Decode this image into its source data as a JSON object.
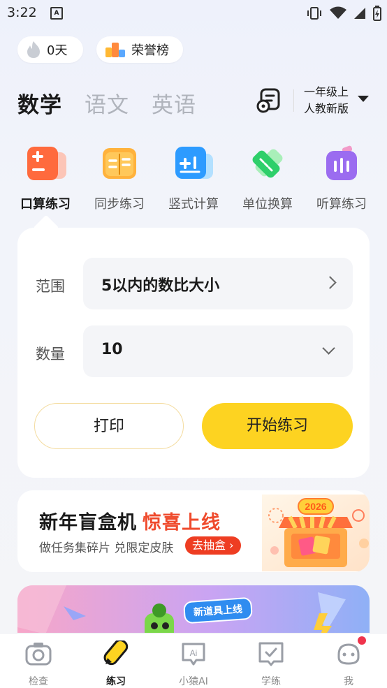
{
  "status_bar": {
    "time": "3:22",
    "notif_letter": "A"
  },
  "chips": {
    "streak": "0天",
    "honor": "荣誉榜"
  },
  "subjects": [
    {
      "label": "数学",
      "active": true
    },
    {
      "label": "语文",
      "active": false
    },
    {
      "label": "英语",
      "active": false
    }
  ],
  "grade": {
    "line1": "一年级上",
    "line2": "人教新版"
  },
  "practice_types": [
    {
      "label": "口算练习",
      "icon": "calculator-icon",
      "active": true
    },
    {
      "label": "同步练习",
      "icon": "book-icon"
    },
    {
      "label": "竖式计算",
      "icon": "vertical-calc-icon"
    },
    {
      "label": "单位换算",
      "icon": "ruler-icon"
    },
    {
      "label": "听算练习",
      "icon": "audio-icon"
    }
  ],
  "form": {
    "range_label": "范围",
    "range_value": "5以内的数比大小",
    "count_label": "数量",
    "count_value": "10",
    "print_button": "打印",
    "start_button": "开始练习"
  },
  "banner": {
    "title_a": "新年盲盒机",
    "title_b": "惊喜上线",
    "subtitle": "做任务集碎片 兑限定皮肤",
    "cta": "去抽盒 ›",
    "badge_year": "2026"
  },
  "banner2": {
    "tag": "新道具上线"
  },
  "bottom_nav": [
    {
      "label": "检查",
      "icon": "camera-icon"
    },
    {
      "label": "练习",
      "icon": "pencil-icon",
      "active": true
    },
    {
      "label": "小猿AI",
      "icon": "ai-icon"
    },
    {
      "label": "学练",
      "icon": "check-book-icon"
    },
    {
      "label": "我",
      "icon": "profile-icon"
    }
  ],
  "colors": {
    "accent_yellow": "#fdd321",
    "accent_red": "#ee3d22",
    "active_text": "#1a1a1a",
    "inactive_text": "#b0b4bc"
  }
}
